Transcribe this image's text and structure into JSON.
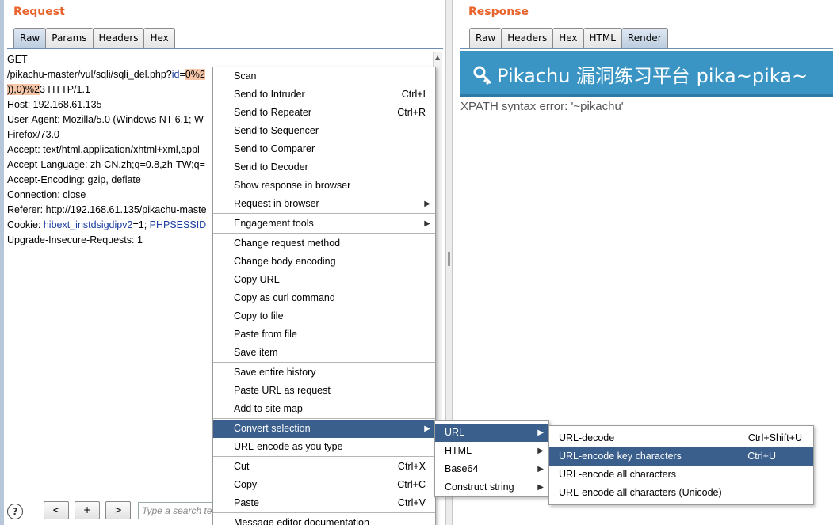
{
  "request": {
    "title": "Request",
    "tabs": [
      "Raw",
      "Params",
      "Headers",
      "Hex"
    ],
    "active_tab": "Raw",
    "lines": {
      "l0": "GET",
      "l1_prefix": "/pikachu-master/vul/sqli/sqli_del.php?",
      "l1_param": "id",
      "l1_eq": "=",
      "l1_hl": "0%2",
      "l2_hl": ")),0)%2",
      "l2_rest": "3 HTTP/1.1",
      "l3": "Host: 192.168.61.135",
      "l4": "User-Agent: Mozilla/5.0 (Windows NT 6.1; W",
      "l5": "Firefox/73.0",
      "l6": "Accept: text/html,application/xhtml+xml,appl",
      "l7": "Accept-Language: zh-CN,zh;q=0.8,zh-TW;q=",
      "l8": "Accept-Encoding: gzip, deflate",
      "l9": "Connection: close",
      "l10": "Referer: http://192.168.61.135/pikachu-maste",
      "l11_prefix": "Cookie: ",
      "l11_p1": "hibext_instdsigdipv2",
      "l11_mid": "=1; ",
      "l11_p2": "PHPSESSID",
      "l12": "Upgrade-Insecure-Requests: 1"
    }
  },
  "bottom_bar": {
    "help": "?",
    "prev": "<",
    "add": "+",
    "next": ">",
    "search_placeholder": "Type a search te"
  },
  "response": {
    "title": "Response",
    "tabs": [
      "Raw",
      "Headers",
      "Hex",
      "HTML",
      "Render"
    ],
    "active_tab": "Render",
    "render_title": "Pikachu 漏洞练习平台 pika~pika~",
    "xpath_error": "XPATH syntax error: '~pikachu'"
  },
  "context_menu": {
    "items": [
      {
        "label": "Scan",
        "shortcut": ""
      },
      {
        "label": "Send to Intruder",
        "shortcut": "Ctrl+I"
      },
      {
        "label": "Send to Repeater",
        "shortcut": "Ctrl+R"
      },
      {
        "label": "Send to Sequencer",
        "shortcut": ""
      },
      {
        "label": "Send to Comparer",
        "shortcut": ""
      },
      {
        "label": "Send to Decoder",
        "shortcut": ""
      },
      {
        "label": "Show response in browser",
        "shortcut": ""
      },
      {
        "label": "Request in browser",
        "shortcut": ""
      },
      {
        "label": "Engagement tools",
        "shortcut": ""
      },
      {
        "label": "Change request method",
        "shortcut": ""
      },
      {
        "label": "Change body encoding",
        "shortcut": ""
      },
      {
        "label": "Copy URL",
        "shortcut": ""
      },
      {
        "label": "Copy as curl command",
        "shortcut": ""
      },
      {
        "label": "Copy to file",
        "shortcut": ""
      },
      {
        "label": "Paste from file",
        "shortcut": ""
      },
      {
        "label": "Save item",
        "shortcut": ""
      },
      {
        "label": "Save entire history",
        "shortcut": ""
      },
      {
        "label": "Paste URL as request",
        "shortcut": ""
      },
      {
        "label": "Add to site map",
        "shortcut": ""
      },
      {
        "label": "Convert selection",
        "shortcut": ""
      },
      {
        "label": "URL-encode as you type",
        "shortcut": ""
      },
      {
        "label": "Cut",
        "shortcut": "Ctrl+X"
      },
      {
        "label": "Copy",
        "shortcut": "Ctrl+C"
      },
      {
        "label": "Paste",
        "shortcut": "Ctrl+V"
      },
      {
        "label": "Message editor documentation",
        "shortcut": ""
      }
    ],
    "submenu_arrow": "▶"
  },
  "convert_submenu": {
    "items": [
      "URL",
      "HTML",
      "Base64",
      "Construct string"
    ]
  },
  "url_submenu": {
    "items": [
      {
        "label": "URL-decode",
        "shortcut": "Ctrl+Shift+U"
      },
      {
        "label": "URL-encode key characters",
        "shortcut": "Ctrl+U"
      },
      {
        "label": "URL-encode all characters",
        "shortcut": ""
      },
      {
        "label": "URL-encode all characters (Unicode)",
        "shortcut": ""
      }
    ]
  },
  "colors": {
    "title_orange": "#e8642c",
    "menu_highlight": "#3a5f8c",
    "render_banner": "#3a95c4",
    "selection_highlight": "#f5c6a8"
  }
}
